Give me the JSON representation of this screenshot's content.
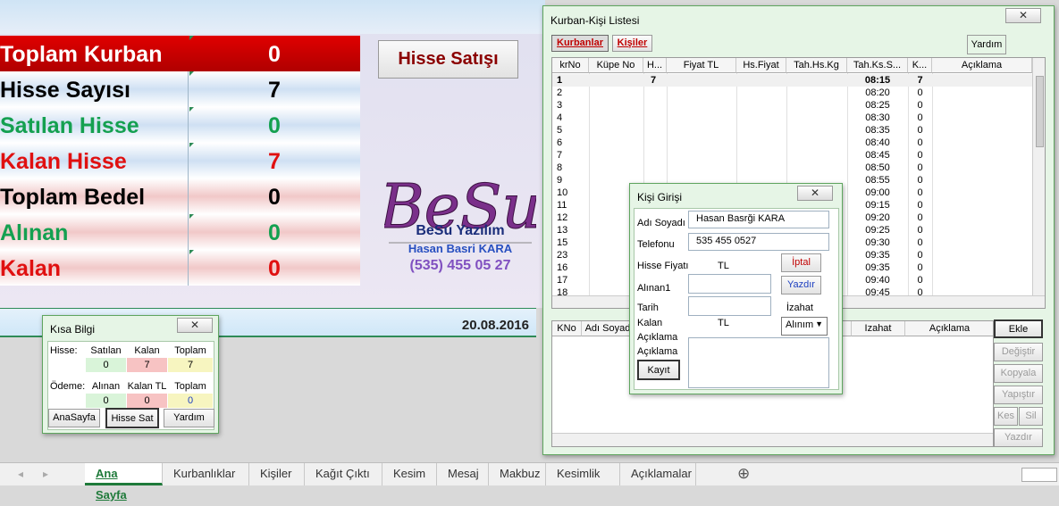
{
  "summary": {
    "rows": [
      {
        "label": "Toplam Kurban",
        "value": "0"
      },
      {
        "label": "Hisse Sayısı",
        "value": "7"
      },
      {
        "label": "Satılan Hisse",
        "value": "0"
      },
      {
        "label": "Kalan Hisse",
        "value": "7"
      },
      {
        "label": "Toplam Bedel",
        "value": "0"
      },
      {
        "label": "Alınan",
        "value": "0"
      },
      {
        "label": "Kalan",
        "value": "0"
      }
    ],
    "hisse_satisi_button": "Hisse Satışı",
    "date": "20.08.2016"
  },
  "logo": {
    "mark": "BeSu",
    "name": "BeSu Yazılım",
    "author": "Hasan Basri KARA",
    "phone": "(535) 455 05 27"
  },
  "kisa_bilgi": {
    "title": "Kısa Bilgi",
    "close": "✕",
    "hisse_label": "Hisse:",
    "hisse_cols": [
      "Satılan",
      "Kalan",
      "Toplam"
    ],
    "hisse_vals": [
      "0",
      "7",
      "7"
    ],
    "odeme_label": "Ödeme:",
    "odeme_cols": [
      "Alınan TL",
      "Kalan TL",
      "Toplam"
    ],
    "odeme_vals": [
      "0",
      "0",
      "0"
    ],
    "buttons": [
      "AnaSayfa",
      "Hisse Sat",
      "Yardım"
    ]
  },
  "kurban_kisi": {
    "title": "Kurban-Kişi Listesi",
    "close": "✕",
    "tabs": [
      "Kurbanlar",
      "Kişiler"
    ],
    "help_button": "Yardım",
    "columns": [
      "krNo",
      "Küpe No",
      "H...",
      "Fiyat TL",
      "Hs.Fiyat",
      "Tah.Hs.Kg",
      "Tah.Ks.S...",
      "K...",
      "Açıklama"
    ],
    "rows": [
      {
        "no": "1",
        "h": "7",
        "time": "08:15",
        "k": "7"
      },
      {
        "no": "2",
        "h": "",
        "time": "08:20",
        "k": "0"
      },
      {
        "no": "3",
        "h": "",
        "time": "08:25",
        "k": "0"
      },
      {
        "no": "4",
        "h": "",
        "time": "08:30",
        "k": "0"
      },
      {
        "no": "5",
        "h": "",
        "time": "08:35",
        "k": "0"
      },
      {
        "no": "6",
        "h": "",
        "time": "08:40",
        "k": "0"
      },
      {
        "no": "7",
        "h": "",
        "time": "08:45",
        "k": "0"
      },
      {
        "no": "8",
        "h": "",
        "time": "08:50",
        "k": "0"
      },
      {
        "no": "9",
        "h": "",
        "time": "08:55",
        "k": "0"
      },
      {
        "no": "10",
        "h": "",
        "time": "09:00",
        "k": "0"
      },
      {
        "no": "11",
        "h": "",
        "time": "09:15",
        "k": "0"
      },
      {
        "no": "12",
        "h": "",
        "time": "09:20",
        "k": "0"
      },
      {
        "no": "13",
        "h": "",
        "time": "09:25",
        "k": "0"
      },
      {
        "no": "15",
        "h": "",
        "time": "09:30",
        "k": "0"
      },
      {
        "no": "23",
        "h": "",
        "time": "09:35",
        "k": "0"
      },
      {
        "no": "16",
        "h": "",
        "time": "09:35",
        "k": "0"
      },
      {
        "no": "17",
        "h": "",
        "time": "09:40",
        "k": "0"
      },
      {
        "no": "18",
        "h": "",
        "time": "09:45",
        "k": "0"
      }
    ],
    "lower_columns": [
      "KNo",
      "Adı Soyadı",
      "Izahat",
      "Açıklama"
    ],
    "side_buttons": [
      "Ekle",
      "Değiştir",
      "Kopyala",
      "Yapıştır",
      "Kes",
      "Sil",
      "Yazdır"
    ]
  },
  "kisi_girisi": {
    "title": "Kişi Girişi",
    "close": "✕",
    "adi_soyadi_label": "Adı Soyadı",
    "adi_soyadi_value": "Hasan Basrği KARA",
    "telefonu_label": "Telefonu",
    "telefonu_value": "535 455 0527",
    "hisse_fiyati_label": "Hisse Fiyatı",
    "tl1": "TL",
    "iptal": "İptal",
    "alinan_label": "Alınan1",
    "yazdir": "Yazdır",
    "tarih_label": "Tarih",
    "izahat_label": "İzahat",
    "kalan_label": "Kalan",
    "tl2": "TL",
    "aciklama1_label": "Açıklama",
    "alinim_value": "Alınım",
    "aciklama2_label": "Açıklama",
    "kayit": "Kayıt"
  },
  "sheet_tabs": {
    "tabs": [
      "Ana Sayfa",
      "Kurbanlıklar",
      "Kişiler",
      "Kağıt Çıktı",
      "Kesim",
      "Mesaj",
      "Makbuz",
      "Kesimlik",
      "Açıklamalar"
    ],
    "add": "⊕"
  }
}
